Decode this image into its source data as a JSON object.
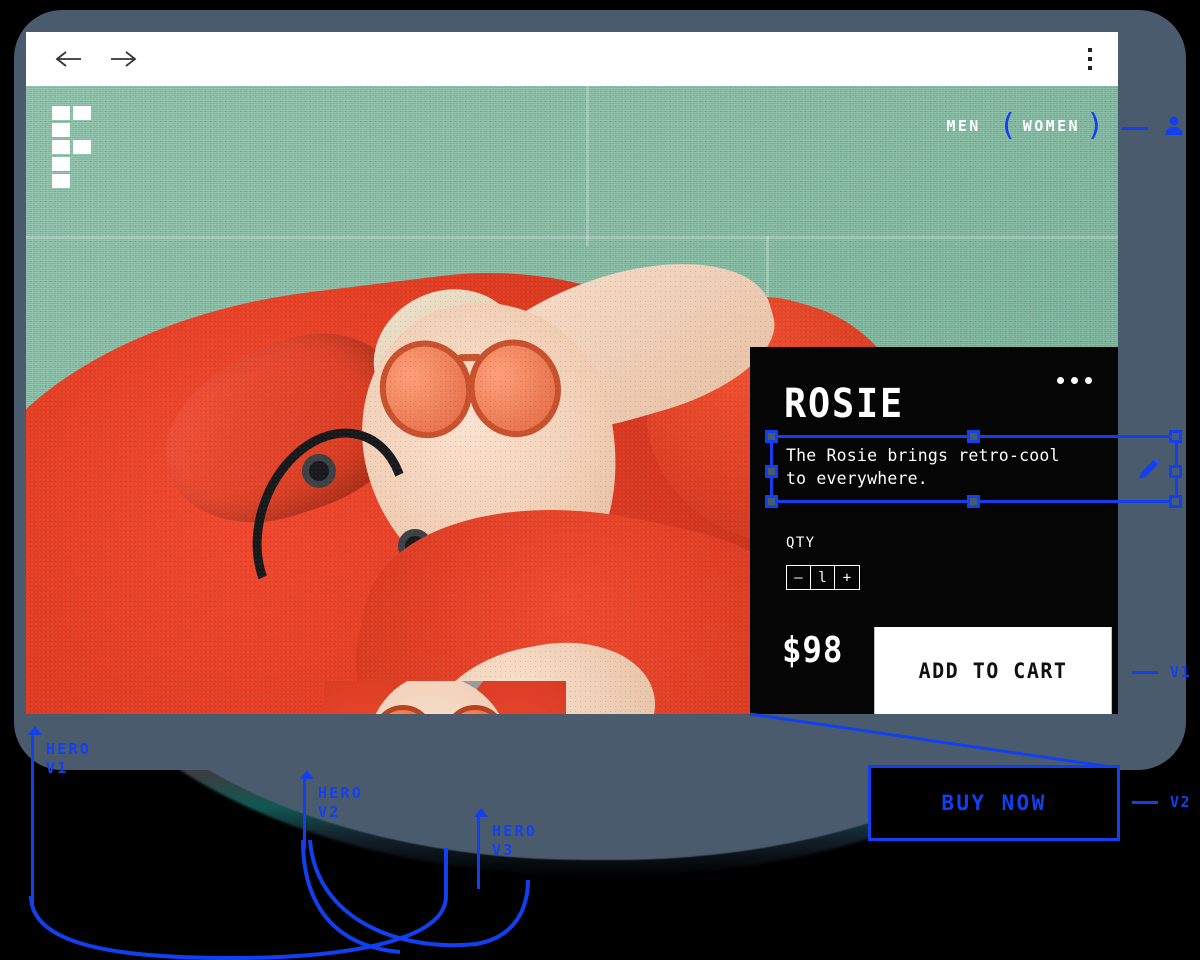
{
  "browser": {
    "back_icon": "arrow-left-icon",
    "forward_icon": "arrow-right-icon",
    "menu_icon": "kebab-menu-icon"
  },
  "site": {
    "logo_alt": "F",
    "nav": {
      "men_label": "MEN",
      "women_label": "WOMEN",
      "paren_open": "(",
      "paren_close": ")"
    }
  },
  "product": {
    "title": "ROSIE",
    "more_icon": "ellipsis-icon",
    "description": "The Rosie brings retro-cool to everywhere.",
    "qty_label": "QTY",
    "qty_minus": "–",
    "qty_value": "l",
    "qty_plus": "+",
    "price": "$98",
    "add_to_cart_label": "ADD TO CART",
    "buy_now_label": "BUY NOW"
  },
  "annotations": {
    "variant_1": "V1",
    "variant_2": "V2",
    "hero_markers": [
      {
        "line1": "HERO",
        "line2": "V1"
      },
      {
        "line1": "HERO",
        "line2": "V2"
      },
      {
        "line1": "HERO",
        "line2": "V3"
      }
    ],
    "edit_icon": "pencil-icon",
    "account_icon": "user-icon",
    "accent_color": "#1240ef"
  },
  "colors": {
    "frame": "#4a5b6e",
    "panel": "#050505",
    "accent": "#1240ef",
    "page_bg": "#000000"
  }
}
